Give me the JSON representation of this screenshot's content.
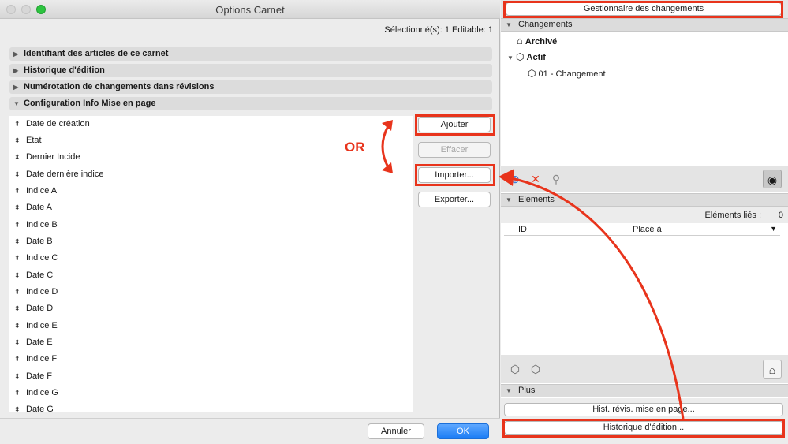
{
  "dialog": {
    "title": "Options Carnet",
    "selection_info": "Sélectionné(s): 1 Editable: 1",
    "sections": [
      {
        "label": "Identifiant des articles de ce carnet",
        "expanded": false
      },
      {
        "label": "Historique d'édition",
        "expanded": false
      },
      {
        "label": "Numérotation de changements dans révisions",
        "expanded": false
      },
      {
        "label": "Configuration Info Mise en page",
        "expanded": true
      }
    ],
    "fields": [
      "Date de création",
      "Etat",
      "Dernier Incide",
      "Date dernière indice",
      "Indice A",
      "Date A",
      "Indice B",
      "Date B",
      "Indice C",
      "Date C",
      "Indice D",
      "Date D",
      "Indice E",
      "Date E",
      "Indice F",
      "Date F",
      "Indice G",
      "Date G"
    ],
    "buttons": {
      "add": "Ajouter",
      "delete": "Effacer",
      "import": "Importer...",
      "export": "Exporter...",
      "cancel": "Annuler",
      "ok": "OK"
    },
    "annotation": "OR"
  },
  "palette": {
    "top_button": "Gestionnaire des changements",
    "changes_header": "Changements",
    "tree": {
      "archived": "Archivé",
      "active": "Actif",
      "change_item": "01 - Changement"
    },
    "elements_header": "Eléments",
    "linked_elements_label": "Eléments liés :",
    "linked_elements_count": "0",
    "columns": {
      "id": "ID",
      "placed": "Placé à"
    },
    "more_header": "Plus",
    "hist_revisions_button": "Hist. révis. mise en page...",
    "edit_history_button": "Historique d'édition..."
  },
  "colors": {
    "highlight": "#e8341c",
    "primary_button": "#1a7cf5",
    "zoom_button": "#2dc440"
  }
}
